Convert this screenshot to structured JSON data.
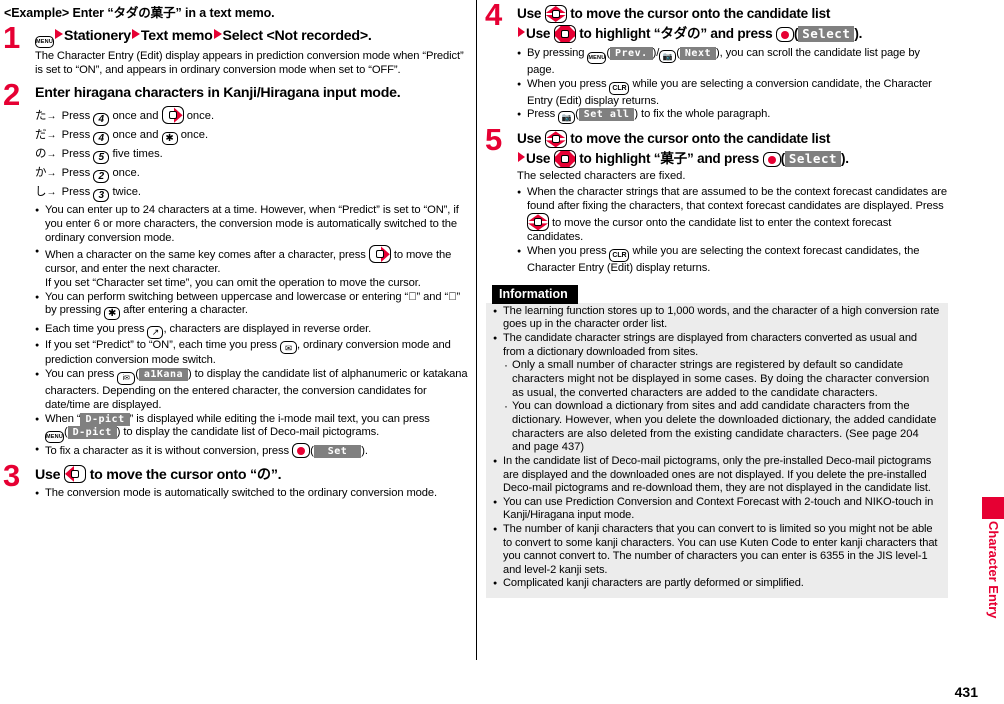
{
  "page": {
    "number": "431",
    "side_tab_label": "Character Entry",
    "accent_color": "#e60033",
    "info_bg": "#ececec"
  },
  "left_column": {
    "example_heading_pre": "<Example> Enter “",
    "example_heading_jp": "タダの菓子",
    "example_heading_post": "” in a text memo.",
    "steps": [
      {
        "num": "1",
        "title_parts": [
          "Stationery",
          "Text memo",
          "Select <Not recorded>."
        ],
        "body": [
          "The Character Entry (Edit) display appears in prediction conversion mode when “Predict” is set to “ON”, and appears in ordinary conversion mode when set to “OFF”."
        ]
      },
      {
        "num": "2",
        "title": "Enter hiragana characters in Kanji/Hiragana input mode.",
        "key_rows": [
          {
            "kana": "た",
            "pre": "Press",
            "key1": "4",
            "mid": "once and",
            "key2": "nav-right",
            "post": "once."
          },
          {
            "kana": "だ",
            "pre": "Press",
            "key1": "4",
            "mid": "once and",
            "key2": "star",
            "post": "once."
          },
          {
            "kana": "の",
            "pre": "Press",
            "key1": "5",
            "mid": "",
            "key2": "",
            "post": "five times."
          },
          {
            "kana": "か",
            "pre": "Press",
            "key1": "2",
            "mid": "",
            "key2": "",
            "post": "once."
          },
          {
            "kana": "し",
            "pre": "Press",
            "key1": "3",
            "mid": "",
            "key2": "",
            "post": "twice."
          }
        ],
        "bullets": [
          "You can enter up to 24 characters at a time. However, when “Predict” is set to “ON”, if you enter 6 or more characters, the conversion mode is automatically switched to the ordinary conversion mode.",
          "When a character on the same key comes after a character, press □ to move the cursor, and enter the next character.",
          "If you set “Character set time”, you can omit the operation to move the cursor.",
          "You can perform switching between uppercase and lowercase or entering “ ゙ ” and “ ゚ ” by pressing □ after entering a character.",
          "Each time you press □ , characters are displayed in reverse order.",
          "If you set “Predict” to “ON”, each time you press □ , ordinary conversion mode and prediction conversion mode switch.",
          "You can press □ (a1Kana) to display the candidate list of alphanumeric or katakana characters. Depending on the entered character, the conversion candidates for date/time are displayed.",
          "When “D-pict” is displayed while editing the i-mode mail text, you can press □ (D-pict) to display the candidate list of Deco-mail pictograms.",
          "To fix a character as it is without conversion, press □ (Set)."
        ],
        "b1_a": "You can enter up to 24 characters at a time. However, when “Predict” is set to “ON”,",
        "b1_b": "if you enter 6 or more characters, the conversion mode is automatically switched",
        "b1_c": "to the ordinary conversion mode.",
        "b2_a": "When a character on the same key comes after a character, press",
        "b2_b": "to move",
        "b2_c": "the cursor, and enter the next character.",
        "b2_d": "If you set “Character set time”, you can omit the operation to move the cursor.",
        "b3_a": "You can perform switching between uppercase and lowercase or entering “゙”",
        "b3_b": "and “゚” by pressing",
        "b3_c": "after entering a character.",
        "b4_a": "Each time you press",
        "b4_b": ", characters are displayed in reverse order.",
        "b5_a": "If you set “Predict” to “ON”, each time you press",
        "b5_b": ", ordinary conversion mode",
        "b5_c": "and prediction conversion mode switch.",
        "b6_a": "You can press",
        "b6_key_label": "a1Kana",
        "b6_b": ") to display the candidate list of alphanumeric or",
        "b6_c": "katakana characters. Depending on the entered character, the conversion",
        "b6_d": "candidates for date/time are displayed.",
        "b7_a": "When “",
        "b7_label": "D-pict",
        "b7_b": "” is displayed while editing the i-mode mail text, you can press",
        "b7_c": ") to display the candidate list of Deco-mail pictograms.",
        "b8_a": "To fix a character as it is without conversion, press",
        "b8_label": "Set",
        "b8_b": ")."
      },
      {
        "num": "3",
        "title_pre": "Use",
        "title_mid": "to move the cursor onto “",
        "title_jp": "の",
        "title_post": "”.",
        "bullets": [
          "The conversion mode is automatically switched to the ordinary conversion mode."
        ]
      }
    ]
  },
  "right_column": {
    "steps": [
      {
        "num": "4",
        "line1_pre": "Use",
        "line1_post": "to move the cursor onto the candidate list",
        "line2_pre": "Use",
        "line2_mid": "to highlight “",
        "line2_jp": "タダの",
        "line2_post": "” and press",
        "line2_softkey": "Select",
        "line2_tail": ").",
        "b1_a": "By pressing",
        "b1_prev": "Prev.",
        "b1_next": "Next",
        "b1_b": "), you can scroll the candidate list page by",
        "b1_c": "page.",
        "b2_a": "When you press",
        "b2_b": "while you are selecting a conversion candidate, the",
        "b2_c": "Character Entry (Edit) display returns.",
        "b3_a": "Press",
        "b3_label": "Set all",
        "b3_b": ") to fix the whole paragraph."
      },
      {
        "num": "5",
        "line1_pre": "Use",
        "line1_post": "to move the cursor onto the candidate list",
        "line2_pre": "Use",
        "line2_mid": "to highlight “",
        "line2_jp": "菓子",
        "line2_post": "” and press",
        "line2_softkey": "Select",
        "line2_tail": ").",
        "body": "The selected characters are fixed.",
        "b1_a": "When the character strings that are assumed to be the context forecast",
        "b1_b": "candidates are found after fixing the characters, that context forecast candidates",
        "b1_c": "are displayed. Press",
        "b1_d": "to move the cursor onto the candidate list to enter the",
        "b1_e": "context forecast candidates.",
        "b2_a": "When you press",
        "b2_b": "while you are selecting the context forecast candidates, the",
        "b2_c": "Character Entry (Edit) display returns."
      }
    ],
    "information": {
      "title": "Information",
      "items": [
        {
          "type": "bullet",
          "lines": [
            "The learning function stores up to 1,000 words, and the character of a high conversion",
            "rate goes up in the character order list."
          ]
        },
        {
          "type": "bullet",
          "lines": [
            "The candidate character strings are displayed from characters converted as usual",
            "and from a dictionary downloaded from sites."
          ]
        },
        {
          "type": "sub",
          "lines": [
            "Only a small number of character strings are registered by default so candidate",
            "characters might not be displayed in some cases. By doing the character conversion",
            "as usual, the converted characters are added to the candidate characters."
          ]
        },
        {
          "type": "sub",
          "lines": [
            "You can download a dictionary from sites and add candidate characters from the",
            "dictionary. However, when you delete the downloaded dictionary, the added",
            "candidate characters are also deleted from the existing candidate characters. (See",
            "page 204 and page 437)"
          ]
        },
        {
          "type": "bullet",
          "lines": [
            "In the candidate list of Deco-mail pictograms, only the pre-installed Deco-mail",
            "pictograms are displayed and the downloaded ones are not displayed. If you delete",
            "the pre-installed Deco-mail pictograms and re-download them, they are not displayed",
            "in the candidate list."
          ]
        },
        {
          "type": "bullet",
          "lines": [
            "You can use Prediction Conversion and Context Forecast with 2-touch and",
            "NIKO-touch in Kanji/Hiragana input mode."
          ]
        },
        {
          "type": "bullet",
          "lines": [
            "The number of kanji characters that you can convert to is limited so you might not be",
            "able to convert to some kanji characters. You can use Kuten Code to enter kanji",
            "characters that you cannot convert to. The number of characters you can enter is",
            "6355 in the JIS level-1 and level-2 kanji sets."
          ]
        },
        {
          "type": "bullet",
          "lines": [
            "Complicated kanji characters are partly deformed or simplified."
          ]
        }
      ]
    }
  },
  "keys": {
    "menu": "MENU",
    "clr": "CLR",
    "num4": "4",
    "num5": "5",
    "num2": "2",
    "num3": "3",
    "star": "✳",
    "mail": "✉",
    "call": "↗",
    "camera": "⬛",
    "imode": "i✉"
  }
}
